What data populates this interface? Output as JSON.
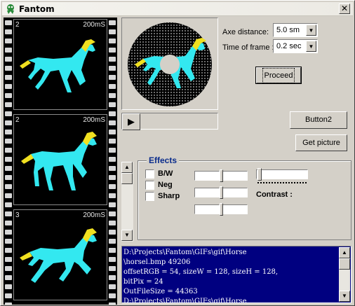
{
  "window": {
    "title": "Fantom",
    "close_glyph": "✕"
  },
  "filmstrip": {
    "frames": [
      {
        "number": "2",
        "duration": "200mS"
      },
      {
        "number": "2",
        "duration": "200mS"
      },
      {
        "number": "3",
        "duration": "200mS"
      }
    ]
  },
  "controls": {
    "play_glyph": "▶",
    "axe_distance_label": "Axe distance:",
    "axe_distance_value": "5.0 sm",
    "time_of_frame_label": "Time of frame :",
    "time_of_frame_value": "0.2 sec",
    "proceed_label": "Proceed",
    "button2_label": "Button2",
    "get_picture_label": "Get picture"
  },
  "effects": {
    "title": "Effects",
    "bw_label": "B/W",
    "neg_label": "Neg",
    "sharp_label": "Sharp",
    "contrast_label": "Contrast :"
  },
  "console": {
    "lines": [
      "D:\\Projects\\Fantom\\GIFs\\gif\\Horse",
      "\\horsel.bmp 49206",
      "offsetRGB = 54, sizeW = 128, sizeH = 128,",
      "bitPix = 24",
      "OutFileSize = 44363",
      "D:\\Projects\\Fantom\\GIFs\\gif\\Horse"
    ]
  },
  "colors": {
    "horse_body": "#33e8f0",
    "horse_mane": "#f0e020",
    "console_bg": "#000080",
    "effects_title": "#0a2c8c"
  },
  "icons": {
    "app": "fantom-app-icon",
    "close": "close-icon",
    "play": "play-icon",
    "dropdown": "chevron-down-icon"
  }
}
